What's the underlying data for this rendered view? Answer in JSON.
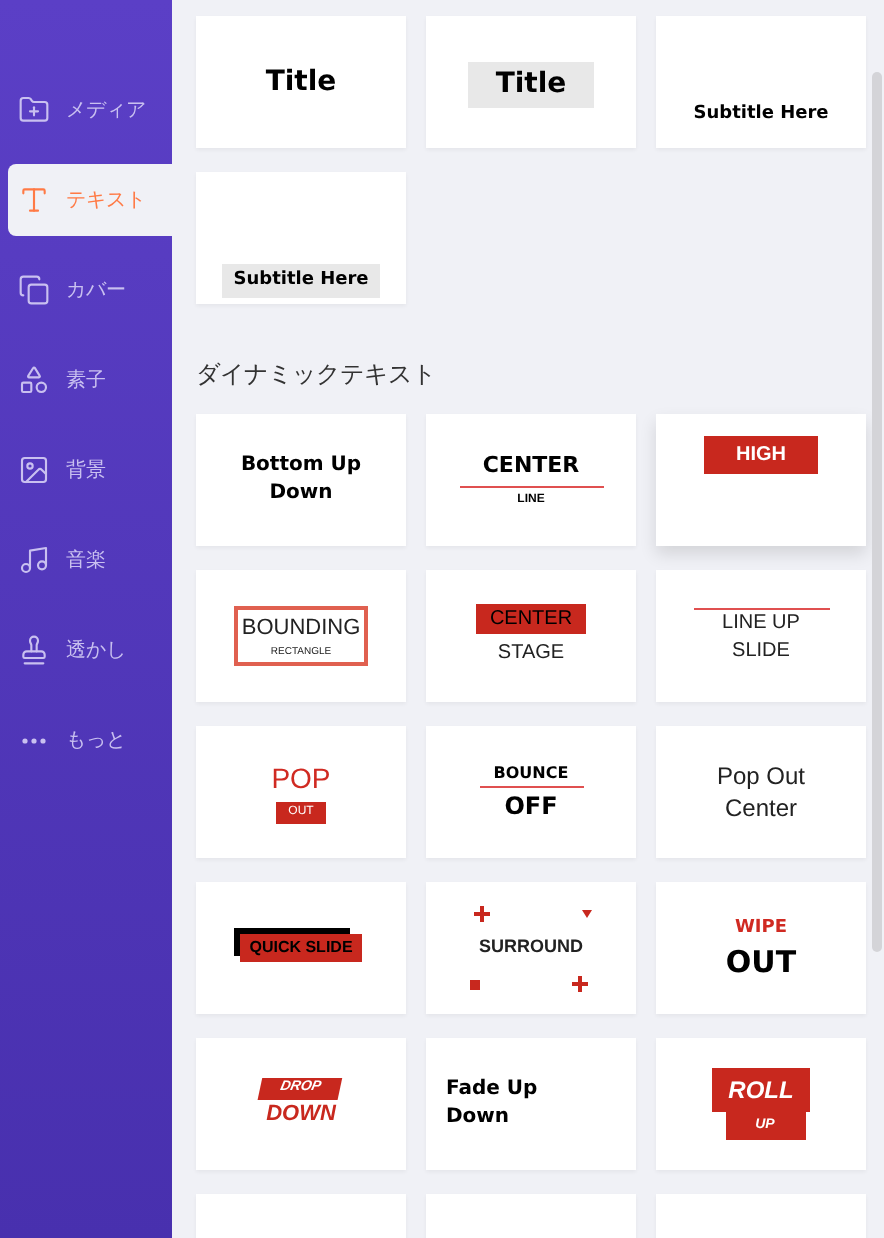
{
  "sidebar": {
    "items": [
      {
        "label": "メディア",
        "selected": false
      },
      {
        "label": "テキスト",
        "selected": true
      },
      {
        "label": "カバー",
        "selected": false
      },
      {
        "label": "素子",
        "selected": false
      },
      {
        "label": "背景",
        "selected": false
      },
      {
        "label": "音楽",
        "selected": false
      },
      {
        "label": "透かし",
        "selected": false
      },
      {
        "label": "もっと",
        "selected": false
      }
    ]
  },
  "basic_cards": [
    {
      "kind": "title-plain",
      "texts": [
        "Title"
      ]
    },
    {
      "kind": "title-boxed",
      "texts": [
        "Title"
      ]
    },
    {
      "kind": "subtitle-plain",
      "texts": [
        "Subtitle Here"
      ]
    },
    {
      "kind": "subtitle-boxed",
      "texts": [
        "Subtitle Here"
      ]
    }
  ],
  "dynamic_section": {
    "heading": "ダイナミックテキスト",
    "cards": [
      {
        "kind": "bold-center",
        "texts": [
          "Bottom Up Down"
        ]
      },
      {
        "kind": "center-line",
        "texts": [
          "CENTER",
          "LINE"
        ]
      },
      {
        "kind": "high",
        "texts": [
          "HIGH"
        ]
      },
      {
        "kind": "bounding",
        "texts": [
          "BOUNDING",
          "RECTANGLE"
        ]
      },
      {
        "kind": "center-stage",
        "texts": [
          "CENTER",
          "STAGE"
        ]
      },
      {
        "kind": "line-up",
        "texts": [
          "LINE UP SLIDE"
        ]
      },
      {
        "kind": "pop",
        "texts": [
          "POP",
          "OUT"
        ]
      },
      {
        "kind": "bounce",
        "texts": [
          "BOUNCE",
          "OFF"
        ]
      },
      {
        "kind": "plain-center",
        "texts": [
          "Pop Out Center"
        ]
      },
      {
        "kind": "quick-slide",
        "texts": [
          "QUICK SLIDE"
        ]
      },
      {
        "kind": "surround",
        "texts": [
          "SURROUND"
        ]
      },
      {
        "kind": "wipe",
        "texts": [
          "WIPE",
          "OUT"
        ]
      },
      {
        "kind": "drop",
        "texts": [
          "DROP",
          "DOWN"
        ]
      },
      {
        "kind": "bold-left",
        "texts": [
          "Fade Up Down"
        ]
      },
      {
        "kind": "roll",
        "texts": [
          "ROLL",
          "UP"
        ]
      },
      {
        "kind": "blank"
      },
      {
        "kind": "blank"
      },
      {
        "kind": "blank"
      }
    ]
  }
}
